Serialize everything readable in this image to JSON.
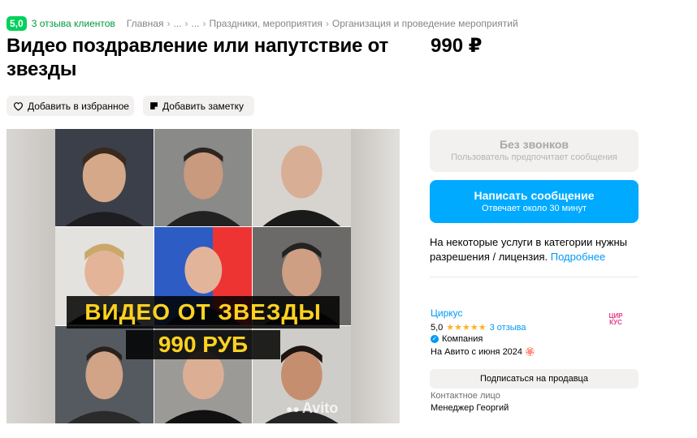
{
  "header": {
    "rating": "5,0",
    "reviews_link": "3 отзыва клиентов",
    "breadcrumbs": [
      "Главная",
      "...",
      "...",
      "Праздники, мероприятия",
      "Организация и проведение мероприятий"
    ],
    "separator": "›"
  },
  "listing": {
    "title": "Видео поздравление или напутствие от звезды",
    "price": "990 ₽"
  },
  "actions": {
    "favorite_label": "Добавить в избранное",
    "note_label": "Добавить заметку"
  },
  "gallery": {
    "promo_line1": "ВИДЕО ОТ ЗВЕЗДЫ",
    "promo_line2": "990 РУБ",
    "watermark": "Avito"
  },
  "contact": {
    "no_calls_label": "Без звонков",
    "no_calls_sub": "Пользователь предпочитает сообщения",
    "message_label": "Написать сообщение",
    "message_sub": "Отвечает около 30 минут"
  },
  "notice": {
    "text": "На некоторые услуги в категории нужны разрешения / лицензия.",
    "link": "Подробнее"
  },
  "seller": {
    "name": "Циркус",
    "rating": "5,0",
    "stars": "★★★★★",
    "reviews": "3 отзыва",
    "type": "Компания",
    "since": "На Авито с июня 2024",
    "avatar_text": "ЦИР КУС",
    "subscribe_label": "Подписаться на продавца",
    "contact_person_label": "Контактное лицо",
    "contact_person_name": "Менеджер Георгий"
  },
  "colors": {
    "accent_green": "#02d15c",
    "link_blue": "#0099f7",
    "button_blue": "#00aaff",
    "promo_yellow": "#ffd21f"
  }
}
